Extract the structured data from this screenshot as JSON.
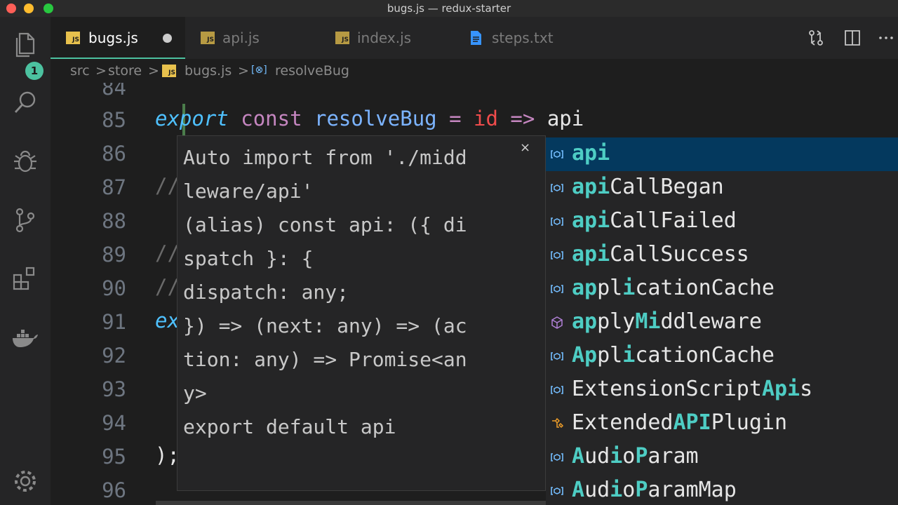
{
  "window": {
    "title": "bugs.js — redux-starter"
  },
  "activity": {
    "badge": "1"
  },
  "tabs": [
    {
      "label": "bugs.js",
      "icon": "JS",
      "active": true,
      "dirty": true
    },
    {
      "label": "api.js",
      "icon": "JS"
    },
    {
      "label": "index.js",
      "icon": "JS"
    },
    {
      "label": "steps.txt",
      "icon": "file-icon"
    }
  ],
  "breadcrumb": {
    "parts": [
      "src",
      "store",
      "bugs.js",
      "resolveBug"
    ],
    "sep": ">",
    "js_badge": "JS",
    "symbol_badge": "[⊗]"
  },
  "editor": {
    "line_numbers": [
      "84",
      "85",
      "86",
      "87",
      "88",
      "89",
      "90",
      "91",
      "92",
      "93",
      "94",
      "95",
      "96"
    ],
    "line85": {
      "kw1": "export",
      "kw2": "const",
      "name": "resolveBug",
      "eq": "=",
      "param": "id",
      "arrow": "=>",
      "typed": "api"
    },
    "fragments": {
      "c87": "//",
      "c89": "//",
      "c90": "//",
      "ex91": "ex",
      "close95": ");"
    }
  },
  "hover": {
    "close": "×",
    "lines": [
      "Auto import from './midd",
      "leware/api'",
      "(alias) const api: ({ di",
      "spatch }: {",
      "dispatch: any;",
      "}) => (next: any) => (ac",
      "tion: any) => Promise<an",
      "y>",
      "export default api"
    ]
  },
  "suggest": {
    "items": [
      {
        "name": "api",
        "kind": "variable"
      },
      {
        "name": "apiCallBegan",
        "kind": "variable"
      },
      {
        "name": "apiCallFailed",
        "kind": "variable"
      },
      {
        "name": "apiCallSuccess",
        "kind": "variable"
      },
      {
        "name": "applicationCache",
        "kind": "variable"
      },
      {
        "name": "applyMiddleware",
        "kind": "method"
      },
      {
        "name": "ApplicationCache",
        "kind": "variable"
      },
      {
        "name": "ExtensionScriptApis",
        "kind": "variable"
      },
      {
        "name": "ExtendedAPIPlugin",
        "kind": "class"
      },
      {
        "name": "AudioParam",
        "kind": "variable"
      },
      {
        "name": "AudioParamMap",
        "kind": "variable"
      }
    ]
  },
  "colors": {
    "accent": "#4cc2a0",
    "match": "#4ecdc4",
    "keyword_export": "#4fc1ff",
    "keyword_const": "#c586c0",
    "function": "#7cb4ff",
    "param": "#f14c4c",
    "arrow": "#c586c0",
    "selection": "#04395e"
  }
}
